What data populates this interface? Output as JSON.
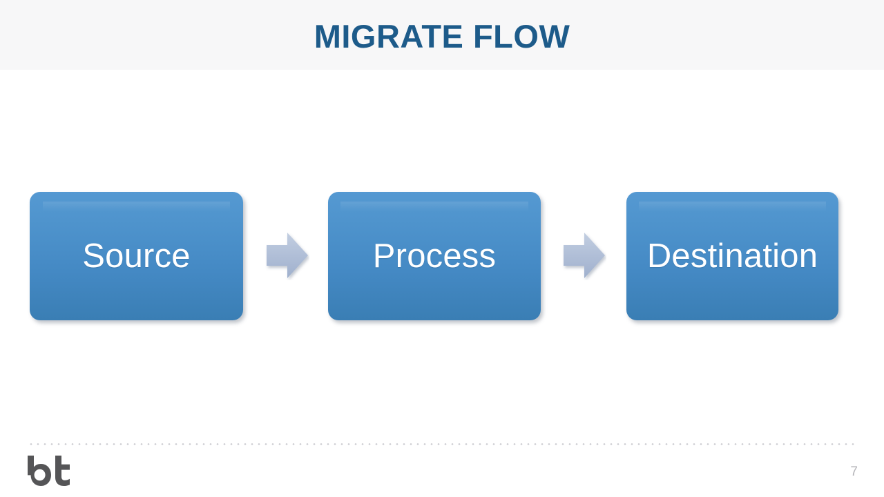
{
  "slide": {
    "title": "MIGRATE FLOW",
    "title_color": "#1d5b8a",
    "header_background": "#f7f7f8",
    "background": "#ffffff"
  },
  "diagram": {
    "type": "process-flow",
    "box_fill_top": "#5599d2",
    "box_fill_bottom": "#3a7eb4",
    "box_label_color": "#ffffff",
    "arrow_color": "#b2c0d8",
    "steps": [
      {
        "label": "Source"
      },
      {
        "label": "Process"
      },
      {
        "label": "Destination"
      }
    ],
    "connectors": [
      {
        "icon": "arrow-right-icon",
        "from": "Source",
        "to": "Process"
      },
      {
        "icon": "arrow-right-icon",
        "from": "Process",
        "to": "Destination"
      }
    ]
  },
  "footer": {
    "logo_text": "bt",
    "logo_color": "#555557",
    "page_number": "7",
    "page_number_color": "#b4b4b8",
    "divider_color": "#cfcfd4"
  }
}
